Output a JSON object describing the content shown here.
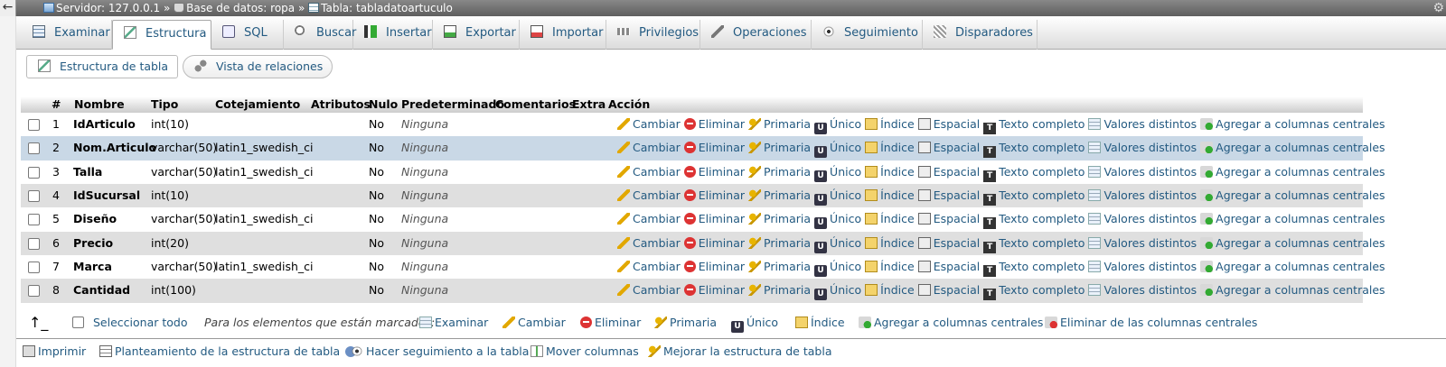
{
  "breadcrumb": {
    "server": "Servidor: 127.0.0.1",
    "sep1": "»",
    "database": "Base de datos: ropa",
    "sep2": "»",
    "table": "Tabla: tabladatoartuculo"
  },
  "tabs": [
    {
      "label": "Examinar",
      "icon": "browse-icon"
    },
    {
      "label": "Estructura",
      "icon": "structure-icon",
      "active": true
    },
    {
      "label": "SQL",
      "icon": "sql-icon"
    },
    {
      "label": "Buscar",
      "icon": "search-icon"
    },
    {
      "label": "Insertar",
      "icon": "insert-icon"
    },
    {
      "label": "Exportar",
      "icon": "export-icon"
    },
    {
      "label": "Importar",
      "icon": "import-icon"
    },
    {
      "label": "Privilegios",
      "icon": "privileges-icon"
    },
    {
      "label": "Operaciones",
      "icon": "wrench-icon"
    },
    {
      "label": "Seguimiento",
      "icon": "eye-icon"
    },
    {
      "label": "Disparadores",
      "icon": "triggers-icon"
    }
  ],
  "subtabs": {
    "structure": "Estructura de tabla",
    "relations": "Vista de relaciones"
  },
  "columns": {
    "num": "#",
    "name": "Nombre",
    "type": "Tipo",
    "collation": "Cotejamiento",
    "attributes": "Atributos",
    "null": "Nulo",
    "default": "Predeterminado",
    "comments": "Comentarios",
    "extra": "Extra",
    "action": "Acción"
  },
  "rows": [
    {
      "num": "1",
      "name": "IdArticulo",
      "type": "int(10)",
      "collation": "",
      "null": "No",
      "default": "Ninguna"
    },
    {
      "num": "2",
      "name": "Nom.Articulo",
      "type": "varchar(50)",
      "collation": "latin1_swedish_ci",
      "null": "No",
      "default": "Ninguna"
    },
    {
      "num": "3",
      "name": "Talla",
      "type": "varchar(50)",
      "collation": "latin1_swedish_ci",
      "null": "No",
      "default": "Ninguna"
    },
    {
      "num": "4",
      "name": "IdSucursal",
      "type": "int(10)",
      "collation": "",
      "null": "No",
      "default": "Ninguna"
    },
    {
      "num": "5",
      "name": "Diseño",
      "type": "varchar(50)",
      "collation": "latin1_swedish_ci",
      "null": "No",
      "default": "Ninguna"
    },
    {
      "num": "6",
      "name": "Precio",
      "type": "int(20)",
      "collation": "",
      "null": "No",
      "default": "Ninguna"
    },
    {
      "num": "7",
      "name": "Marca",
      "type": "varchar(50)",
      "collation": "latin1_swedish_ci",
      "null": "No",
      "default": "Ninguna"
    },
    {
      "num": "8",
      "name": "Cantidad",
      "type": "int(100)",
      "collation": "",
      "null": "No",
      "default": "Ninguna"
    }
  ],
  "row_actions": {
    "change": "Cambiar",
    "drop": "Eliminar",
    "primary": "Primaria",
    "unique": "Único",
    "index": "Índice",
    "spatial": "Espacial",
    "fulltext": "Texto completo",
    "distinct": "Valores distintos",
    "central": "Agregar a columnas centrales"
  },
  "bulk": {
    "select_all": "Seleccionar todo",
    "marked_note": "Para los elementos que están marcados:",
    "browse": "Examinar",
    "change": "Cambiar",
    "drop": "Eliminar",
    "primary": "Primaria",
    "unique": "Único",
    "index": "Índice",
    "add_central": "Agregar a columnas centrales",
    "remove_central": "Eliminar de las columnas centrales"
  },
  "footer": {
    "print": "Imprimir",
    "plan": "Planteamiento de la estructura de tabla",
    "track": "Hacer seguimiento a la tabla",
    "move": "Mover columnas",
    "improve": "Mejorar la estructura de tabla"
  }
}
